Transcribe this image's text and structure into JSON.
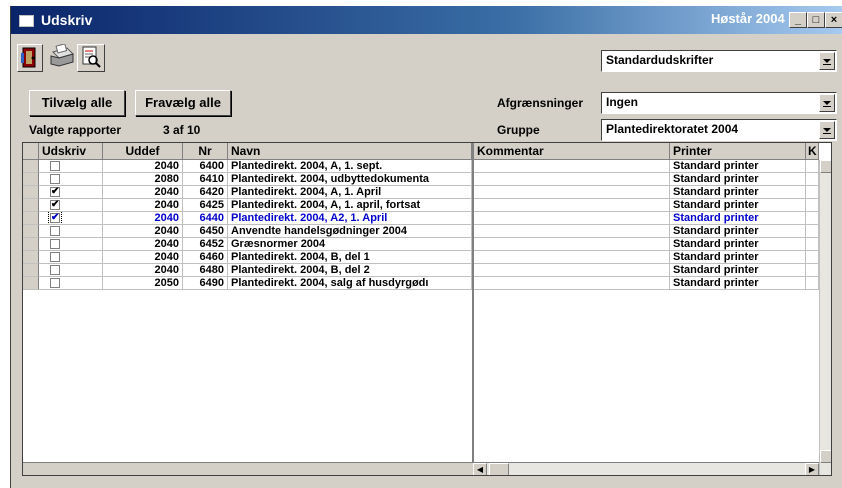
{
  "window": {
    "title": "Udskriv",
    "season": "Høstår 2004"
  },
  "titlebar_buttons": [
    "_",
    "□",
    "×"
  ],
  "toolbar": {
    "icons": [
      "exit-door-icon",
      "printer-icon",
      "print-preview-icon"
    ],
    "report_type": "Standardudskrifter"
  },
  "buttons": {
    "select_all": "Tilvælg alle",
    "deselect_all": "Fravælg alle"
  },
  "status": {
    "selected_label": "Valgte rapporter",
    "selected_count": "3 af 10"
  },
  "filters": {
    "limits_label": "Afgrænsninger",
    "limits_value": "Ingen",
    "group_label": "Gruppe",
    "group_value": "Plantedirektoratet 2004"
  },
  "table": {
    "columns": [
      "Udskriv",
      "Uddef",
      "Nr",
      "Navn",
      "Kommentar",
      "Printer",
      "K"
    ],
    "rows": [
      {
        "checked": false,
        "uddef": "2040",
        "nr": "6400",
        "navn": "Plantedirekt. 2004, A, 1. sept.",
        "kommentar": "",
        "printer": "Standard printer",
        "current": false
      },
      {
        "checked": false,
        "uddef": "2080",
        "nr": "6410",
        "navn": "Plantedirekt. 2004, udbyttedokumenta",
        "kommentar": "",
        "printer": "Standard printer",
        "current": false
      },
      {
        "checked": true,
        "uddef": "2040",
        "nr": "6420",
        "navn": "Plantedirekt. 2004, A, 1. April",
        "kommentar": "",
        "printer": "Standard printer",
        "current": false
      },
      {
        "checked": true,
        "uddef": "2040",
        "nr": "6425",
        "navn": "Plantedirekt. 2004, A, 1. april, fortsat",
        "kommentar": "",
        "printer": "Standard printer",
        "current": false
      },
      {
        "checked": true,
        "uddef": "2040",
        "nr": "6440",
        "navn": "Plantedirekt. 2004, A2, 1. April",
        "kommentar": "",
        "printer": "Standard printer",
        "current": true
      },
      {
        "checked": false,
        "uddef": "2040",
        "nr": "6450",
        "navn": "Anvendte handelsgødninger 2004",
        "kommentar": "",
        "printer": "Standard printer",
        "current": false
      },
      {
        "checked": false,
        "uddef": "2040",
        "nr": "6452",
        "navn": "Græsnormer 2004",
        "kommentar": "",
        "printer": "Standard printer",
        "current": false
      },
      {
        "checked": false,
        "uddef": "2040",
        "nr": "6460",
        "navn": "Plantedirekt. 2004, B, del 1",
        "kommentar": "",
        "printer": "Standard printer",
        "current": false
      },
      {
        "checked": false,
        "uddef": "2040",
        "nr": "6480",
        "navn": "Plantedirekt. 2004, B, del 2",
        "kommentar": "",
        "printer": "Standard printer",
        "current": false
      },
      {
        "checked": false,
        "uddef": "2050",
        "nr": "6490",
        "navn": "Plantedirekt. 2004, salg af husdyrgødı",
        "kommentar": "",
        "printer": "Standard printer",
        "current": false
      }
    ]
  },
  "colors": {
    "titlebar": "#0a246a",
    "current_row_text": "#0000cc",
    "face": "#d4d0c8"
  }
}
